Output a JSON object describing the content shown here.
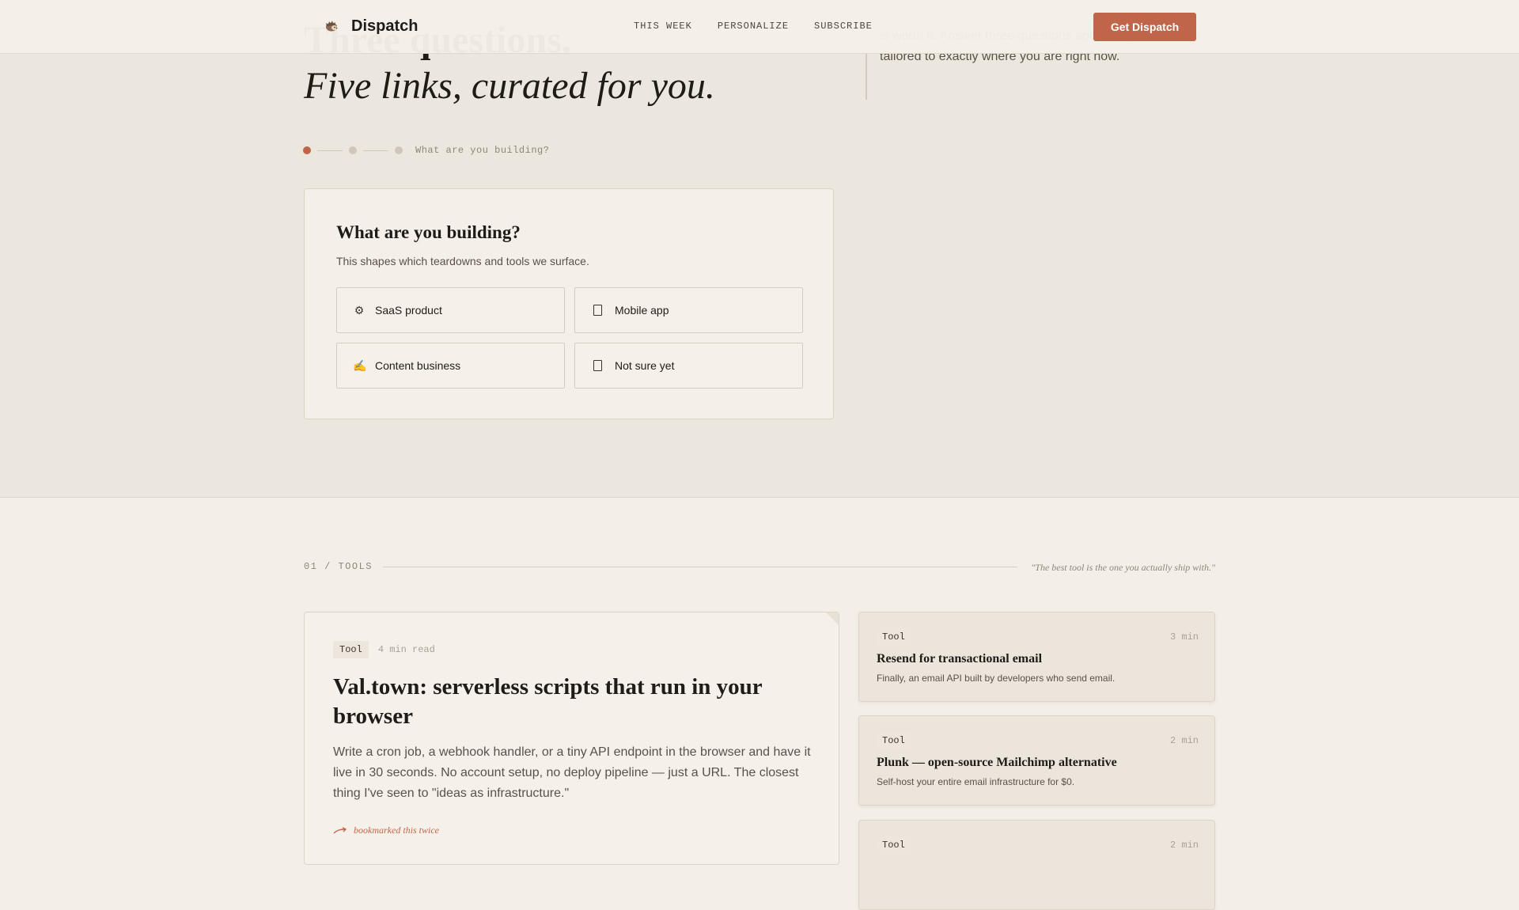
{
  "header": {
    "logo_text": "Dispatch",
    "logo_icon": "hedgehog-icon",
    "nav": [
      "THIS WEEK",
      "PERSONALIZE",
      "SUBSCRIBE"
    ],
    "cta_label": "Get Dispatch"
  },
  "hero": {
    "heading_line1": "Three questions.",
    "heading_line2": "Five links, curated for you.",
    "intro": "is worth it. Answer three questions and we'll pull five links tailored to exactly where you are right now.",
    "step_label": "What are you building?",
    "steps_total": 3,
    "step_current": 1
  },
  "question": {
    "title": "What are you building?",
    "subtitle": "This shapes which teardowns and tools we surface.",
    "options": [
      {
        "label": "SaaS product",
        "icon": "gear-icon"
      },
      {
        "label": "Mobile app",
        "icon": "phone-icon"
      },
      {
        "label": "Content business",
        "icon": "writing-hand-icon"
      },
      {
        "label": "Not sure yet",
        "icon": "square-icon"
      }
    ]
  },
  "section": {
    "label": "01 / TOOLS",
    "quote": "\"The best tool is the one you actually ship with.\""
  },
  "feature": {
    "badge": "Tool",
    "read_time": "4 min read",
    "title": "Val.town: serverless scripts that run in your browser",
    "description": "Write a cron job, a webhook handler, or a tiny API endpoint in the browser and have it live in 30 seconds. No account setup, no deploy pipeline — just a URL. The closest thing I've seen to \"ideas as infrastructure.\"",
    "note": "bookmarked this twice"
  },
  "side_cards": [
    {
      "badge": "Tool",
      "time": "3 min",
      "title": "Resend for transactional email",
      "description": "Finally, an email API built by developers who send email."
    },
    {
      "badge": "Tool",
      "time": "2 min",
      "title": "Plunk — open-source Mailchimp alternative",
      "description": "Self-host your entire email infrastructure for $0."
    },
    {
      "badge": "Tool",
      "time": "2 min",
      "title": "",
      "description": ""
    }
  ],
  "colors": {
    "accent": "#c0654a",
    "background": "#f3efe8",
    "hero_band": "#ece7de",
    "text": "#1f1b16"
  }
}
